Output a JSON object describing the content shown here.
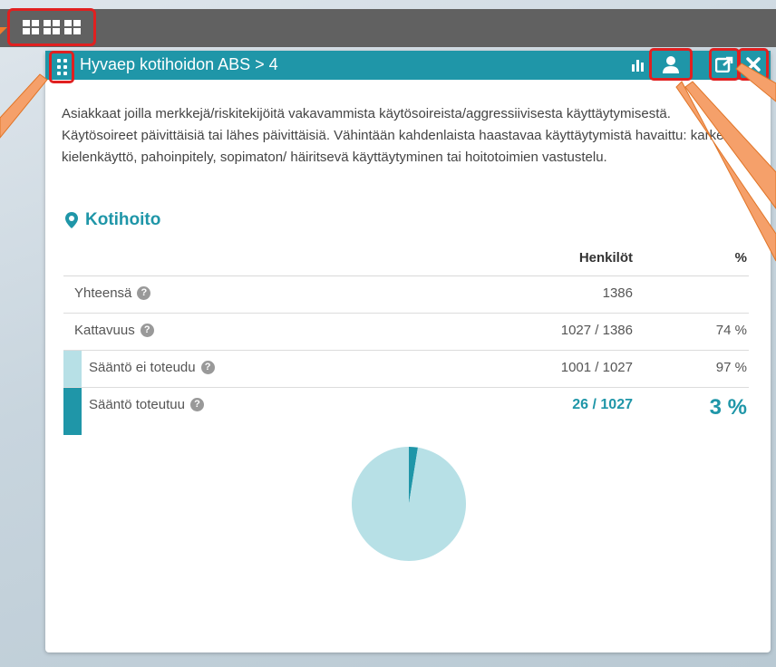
{
  "colors": {
    "accent": "#1f96a8",
    "light_accent": "#b7e0e6",
    "topbar": "#616161",
    "highlight": "#e02020",
    "annotation": "#f07b2c"
  },
  "toolbar": {
    "layout_icons": [
      "grid-2x2-icon",
      "grid-3x2-icon",
      "grid-mixed-icon"
    ]
  },
  "panel": {
    "title": "Hyvaep kotihoidon ABS > 4",
    "header_icons": [
      "drag-handle-icon",
      "bar-chart-icon",
      "user-icon",
      "share-icon",
      "close-icon"
    ],
    "description": "Asiakkaat joilla merkkejä/riskitekijöitä vakavammista käytösoireista/aggressiivisesta käyttäytymisestä. Käytösoireet päivittäisiä tai lähes päivittäisiä. Vähintään kahdenlaista haastavaa käyttäytymistä havaittu: karkea kielenkäyttö, pahoinpitely, sopimaton/ häiritsevä käyttäytyminen tai hoitotoimien vastustelu.",
    "location": "Kotihoito",
    "table": {
      "headers": {
        "count": "Henkilöt",
        "pct": "%"
      },
      "rows": [
        {
          "label": "Yhteensä",
          "value": "1386",
          "pct": ""
        },
        {
          "label": "Kattavuus",
          "value": "1027 / 1386",
          "pct": "74 %"
        },
        {
          "label": "Sääntö ei toteudu",
          "value": "1001 / 1027",
          "pct": "97 %"
        },
        {
          "label": "Sääntö toteutuu",
          "value": "26 / 1027",
          "pct": "3 %"
        }
      ]
    }
  },
  "chart_data": {
    "type": "pie",
    "slices": [
      {
        "label": "Sääntö toteutuu",
        "value": 26,
        "color": "#1f96a8"
      },
      {
        "label": "Sääntö ei toteudu",
        "value": 1001,
        "color": "#b7e0e6"
      }
    ]
  }
}
